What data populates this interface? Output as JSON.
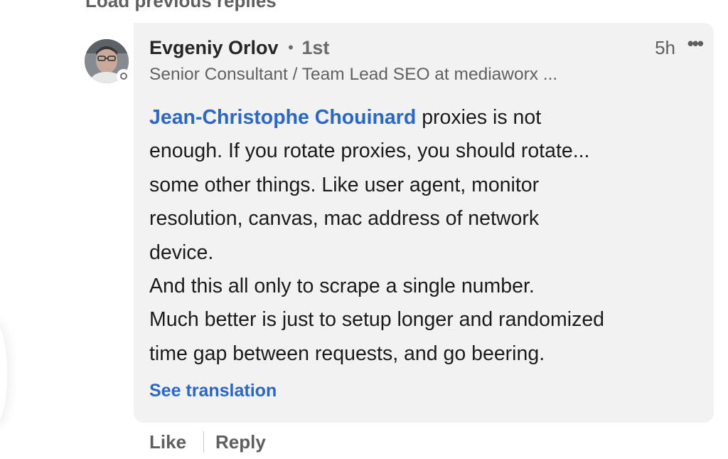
{
  "thread": {
    "load_previous_label": "Load previous replies"
  },
  "comment": {
    "author": {
      "name": "Evgeniy Orlov",
      "separator": "•",
      "degree": "1st",
      "headline": "Senior Consultant / Team Lead SEO at mediaworx ..."
    },
    "time": "5h",
    "more_label": "•••",
    "mention": "Jean-Christophe Chouinard",
    "body_lines": [
      " proxies is not",
      "enough. If you rotate proxies, you should rotate...",
      "some other things. Like user agent, monitor",
      "resolution, canvas,  mac address of network",
      "device.",
      "And this all only to scrape a single number.",
      "Much better is just to setup longer and randomized",
      "time gap between requests, and go beering."
    ],
    "see_translation_label": "See translation"
  },
  "actions": {
    "like_label": "Like",
    "reply_label": "Reply"
  },
  "icons": {
    "avatar": "profile-photo",
    "presence": "presence-indicator-icon",
    "more": "more-options-icon"
  },
  "colors": {
    "link": "#2b66c9",
    "bubble": "#f2f2f2",
    "text": "#1b1b1b",
    "muted": "#5f5f5f"
  }
}
